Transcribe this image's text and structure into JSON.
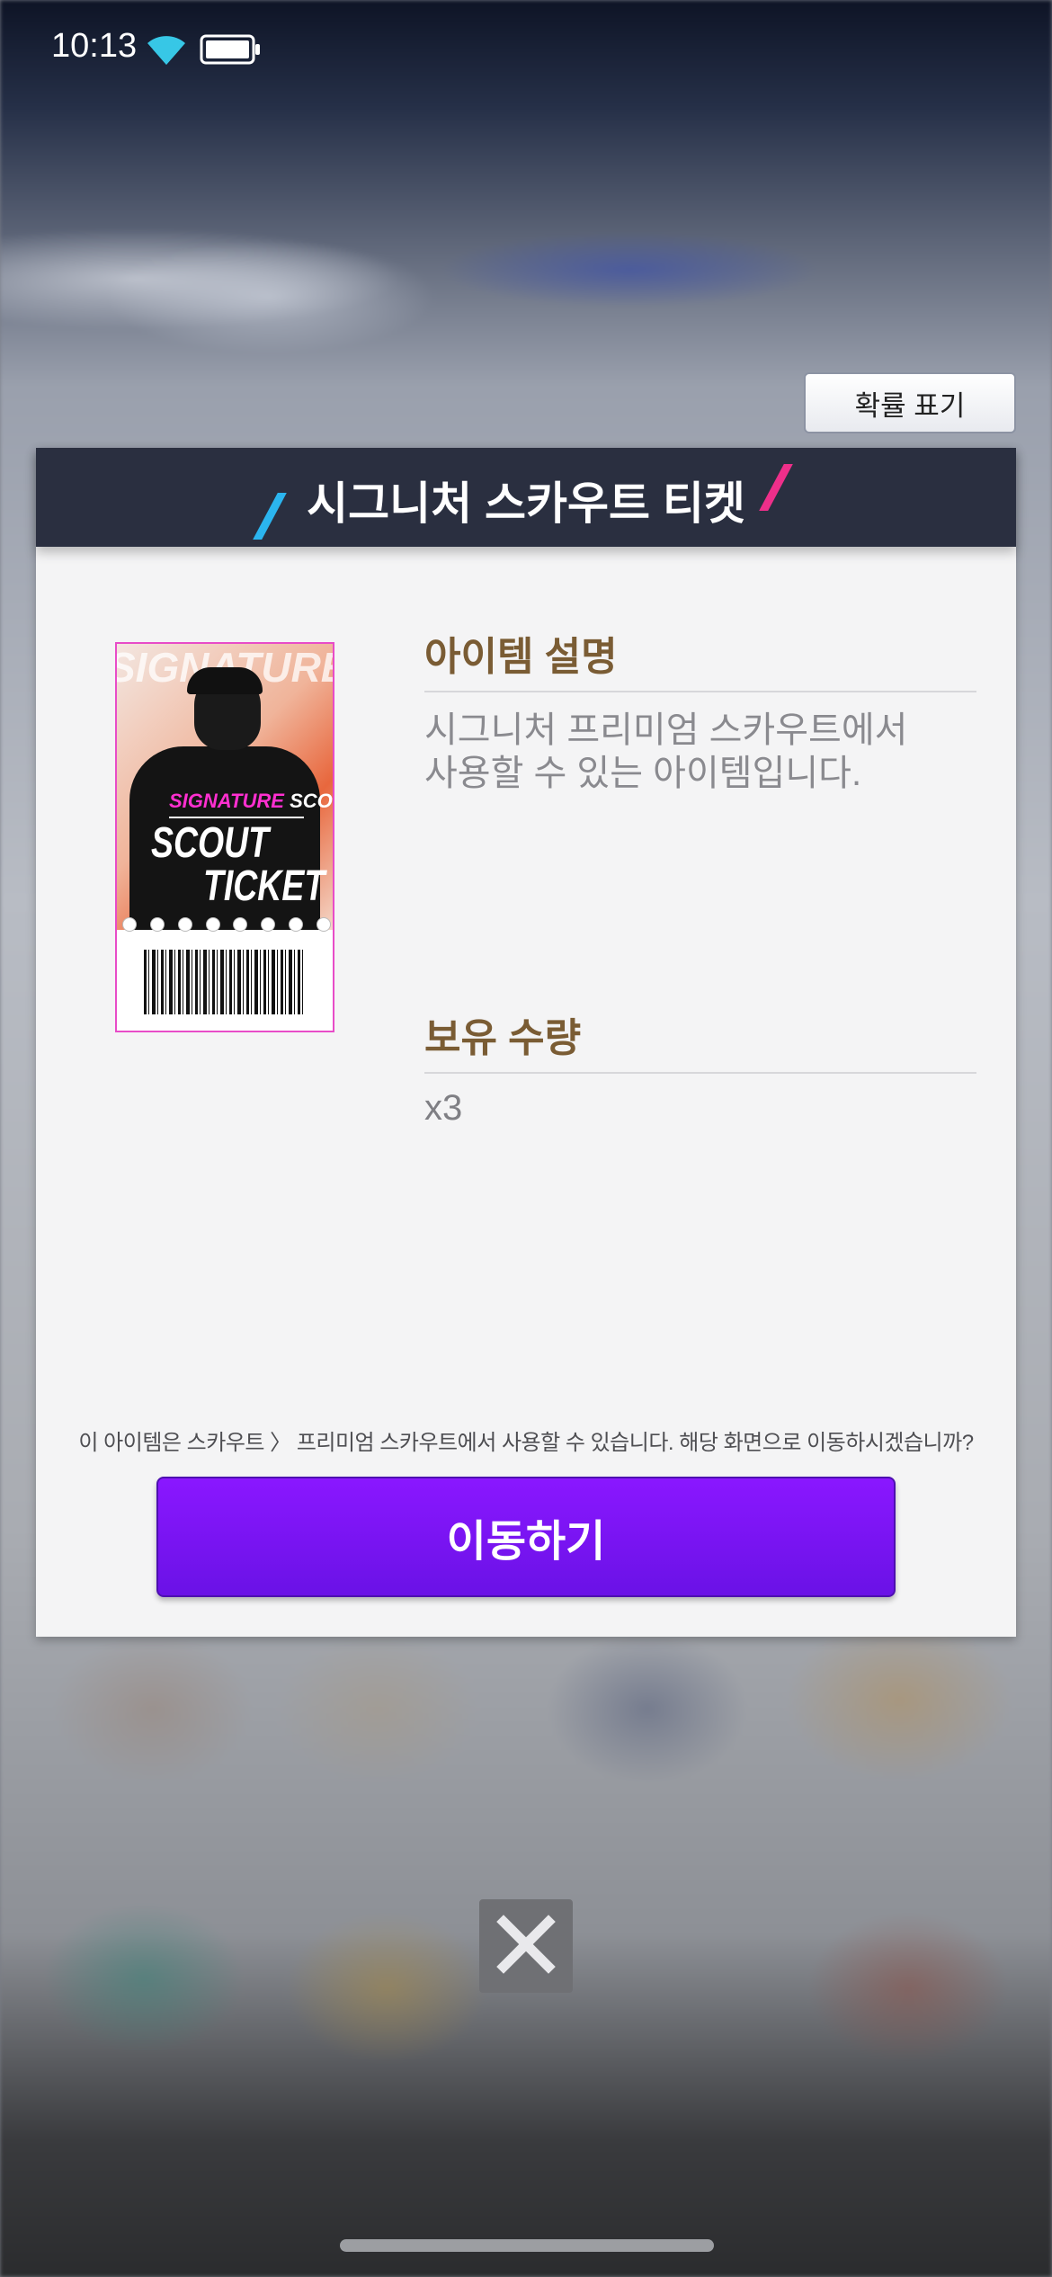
{
  "status_bar": {
    "time": "10:13",
    "icons": [
      "wifi-icon",
      "battery-icon"
    ]
  },
  "probability_button": {
    "label": "확률 표기"
  },
  "modal": {
    "title": "시그니처 스카우트 티켓",
    "accent_colors": {
      "left_slash": "#2bb5ef",
      "right_slash": "#ee2f8a",
      "header_bg": "#2a2f40"
    },
    "ticket_image": {
      "background_text": "SIGNATURE SQUAD PA",
      "label_signature": "SIGNATURE",
      "label_scout": "SCOUT",
      "line1": "SCOUT",
      "line2": "TICKET"
    },
    "description_section": {
      "title": "아이템 설명",
      "text_line1": "시그니처 프리미엄 스카우트에서",
      "text_line2": "사용할 수 있는 아이템입니다."
    },
    "quantity_section": {
      "title": "보유 수량",
      "value": "x3"
    },
    "notice": "이 아이템은 스카우트 〉 프리미엄 스카우트에서 사용할 수 있습니다. 해당 화면으로 이동하시겠습니까?",
    "move_button": {
      "label": "이동하기",
      "color": "#7a14f5"
    }
  },
  "close_button": {
    "icon": "close-icon"
  }
}
